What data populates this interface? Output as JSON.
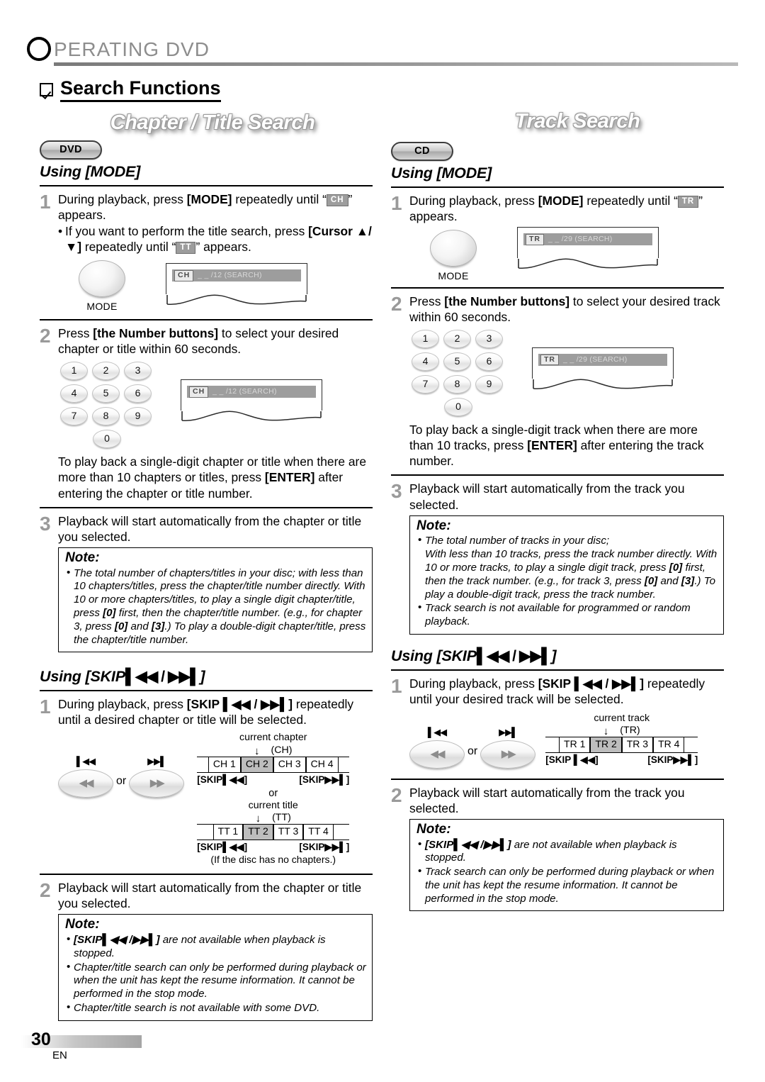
{
  "page": {
    "header_title": "OPERATING DVD",
    "header_first_letter": "O",
    "header_rest": "PERATING  DVD",
    "section_title": "Search Functions",
    "page_number": "30",
    "language_code": "EN"
  },
  "left": {
    "banner": "Chapter / Title Search",
    "badge": "DVD",
    "mode_section": {
      "heading": "Using [MODE]",
      "step1": {
        "num": "1",
        "text_a": "During playback, press ",
        "text_b": "[MODE]",
        "text_c": " repeatedly until “",
        "chip": "CH",
        "text_d": "” appears.",
        "bullet_a": "If you want to perform the title search, press ",
        "bullet_b": "[Cursor ▲/ ▼]",
        "bullet_c": " repeatedly until “",
        "bullet_chip": "TT",
        "bullet_d": "” appears."
      },
      "mode_button_label": "MODE",
      "osd": {
        "chip": "CH",
        "text": "_ _ /12   (SEARCH)"
      },
      "step2": {
        "num": "2",
        "text_a": "Press ",
        "text_b": "[the Number buttons]",
        "text_c": " to select your desired chapter or title within 60 seconds.",
        "after_a": "To play back a single-digit chapter or title when there are more than 10 chapters or titles, press ",
        "after_b": "[ENTER]",
        "after_c": " after entering the chapter or title number."
      },
      "step3": {
        "num": "3",
        "text": "Playback will start automatically from the chapter or title you selected."
      },
      "note": {
        "heading": "Note:",
        "items": [
          "The total number of chapters/titles in your disc; with less than 10 chapters/titles, press the chapter/title number directly. With 10 or more chapters/titles, to play a single digit chapter/title, press [0] first, then the chapter/title number. (e.g., for chapter 3, press [0] and [3].) To play a double-digit chapter/title, press the chapter/title number."
        ]
      }
    },
    "skip_section": {
      "heading_a": "Using [SKIP",
      "heading_b": "▌◀◀ / ▶▶▌",
      "heading_c": "]",
      "step1": {
        "num": "1",
        "text_a": "During playback, press ",
        "text_b": "[SKIP ▌◀◀ / ▶▶▌]",
        "text_c": " repeatedly until a desired chapter or title will be selected."
      },
      "or_label": "or",
      "skip_prev_glyph": "▌◀◀",
      "skip_next_glyph": "▶▶▌",
      "skip_prev_face": "◀◀",
      "skip_next_face": "▶▶",
      "diagram_chapter": {
        "current_label": "current chapter",
        "kind": "(CH)",
        "arrow": "↓",
        "cells": [
          "CH 1",
          "CH 2",
          "CH 3",
          "CH 4"
        ],
        "active_index": 1,
        "skip_left": "[SKIP▌◀◀]",
        "skip_right": "[SKIP▶▶▌]"
      },
      "diagram_or": "or",
      "diagram_title": {
        "current_label": "current title",
        "kind": "(TT)",
        "arrow": "↓",
        "cells": [
          "TT 1",
          "TT 2",
          "TT 3",
          "TT 4"
        ],
        "active_index": 1,
        "skip_left": "[SKIP▌◀◀]",
        "skip_right": "[SKIP▶▶▌]",
        "footnote": "(If the disc has no chapters.)"
      },
      "step2": {
        "num": "2",
        "text": "Playback will start automatically from the chapter or title you selected."
      },
      "note": {
        "heading": "Note:",
        "items": [
          "[SKIP ▌◀◀ / ▶▶▌] are not available when playback is stopped.",
          "Chapter/title search can only be performed during playback or when the unit has kept the resume information. It cannot be performed in the stop mode.",
          "Chapter/title search is not available with some DVD."
        ]
      }
    }
  },
  "right": {
    "banner": "Track Search",
    "badge": "CD",
    "mode_section": {
      "heading": "Using [MODE]",
      "step1": {
        "num": "1",
        "text_a": "During playback, press ",
        "text_b": "[MODE]",
        "text_c": " repeatedly until “",
        "chip": "TR",
        "text_d": "” appears."
      },
      "mode_button_label": "MODE",
      "osd": {
        "chip": "TR",
        "text": "_ _ /29   (SEARCH)"
      },
      "step2": {
        "num": "2",
        "text_a": "Press ",
        "text_b": "[the Number buttons]",
        "text_c": " to select your desired track within 60 seconds.",
        "after_a": "To play back a single-digit track when there are more than 10 tracks, press ",
        "after_b": "[ENTER]",
        "after_c": " after entering the track number."
      },
      "step3": {
        "num": "3",
        "text": "Playback will start automatically from the track you selected."
      },
      "note": {
        "heading": "Note:",
        "items": [
          "The total number of tracks in your disc; With less than 10 tracks, press the track number directly. With 10 or more tracks, to play a single digit track, press [0] first, then the track number. (e.g., for track 3, press [0] and [3].)  To play a double-digit track, press the track number.",
          "Track search is not available for programmed or random playback."
        ]
      }
    },
    "skip_section": {
      "heading_a": "Using [SKIP",
      "heading_b": "▌◀◀ / ▶▶▌",
      "heading_c": "]",
      "step1": {
        "num": "1",
        "text_a": "During playback, press ",
        "text_b": "[SKIP ▌◀◀ / ▶▶▌]",
        "text_c": " repeatedly until your desired track will be selected."
      },
      "or_label": "or",
      "skip_prev_glyph": "▌◀◀",
      "skip_next_glyph": "▶▶▌",
      "skip_prev_face": "◀◀",
      "skip_next_face": "▶▶",
      "diagram_track": {
        "current_label": "current track",
        "kind": "(TR)",
        "arrow": "↓",
        "cells": [
          "TR 1",
          "TR 2",
          "TR 3",
          "TR 4"
        ],
        "active_index": 1,
        "skip_left": "[SKIP ▌◀◀]",
        "skip_right": "[SKIP▶▶▌]"
      },
      "step2": {
        "num": "2",
        "text": "Playback will start automatically from the track you selected."
      },
      "note": {
        "heading": "Note:",
        "items": [
          "[SKIP ▌◀◀ / ▶▶▌] are not available when playback is stopped.",
          "Track search can only be performed during playback or when the unit has kept the resume information. It cannot be performed in the stop mode."
        ]
      }
    }
  },
  "numpad": {
    "rows": [
      [
        "1",
        "2",
        "3"
      ],
      [
        "4",
        "5",
        "6"
      ],
      [
        "7",
        "8",
        "9"
      ]
    ],
    "zero": "0"
  },
  "colors": {
    "step_number": "#9a9a9a",
    "osd_bar": "#9d9d9d",
    "active_cell": "#bdbdbd"
  }
}
